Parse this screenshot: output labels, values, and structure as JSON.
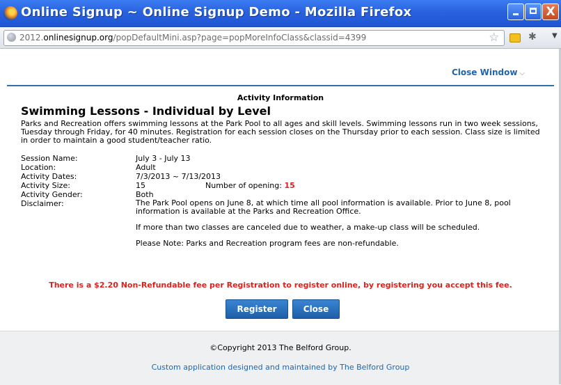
{
  "window": {
    "title": "Online Signup ~ Online Signup Demo - Mozilla Firefox",
    "controls": {
      "minimize": "",
      "maximize": "",
      "close": "X"
    }
  },
  "browser": {
    "url_prefix": "2012.",
    "url_domain": "onlinesignup.org",
    "url_path": "/popDefaultMini.asp?page=popMoreInfoClass&classid=4399",
    "icons": [
      "globe-icon",
      "star-icon",
      "addon-icon",
      "addon-icon",
      "menu-arrow-icon"
    ]
  },
  "page": {
    "close_window": "Close Window",
    "section_heading": "Activity Information",
    "activity_title": "Swimming Lessons - Individual by Level",
    "description": "Parks and Recreation offers swimming lessons at the Park Pool to all ages and skill levels. Swimming lessons run in two week sessions, Tuesday through Friday, for 40 minutes. Registration for each session closes on the Thursday prior to each session. Class size is limited in order to maintain a good student/teacher ratio.",
    "details": {
      "session_name_label": "Session Name:",
      "session_name": "July 3 - July 13",
      "location_label": "Location:",
      "location": "Adult",
      "dates_label": "Activity Dates:",
      "dates": "7/3/2013 ~ 7/13/2013",
      "size_label": "Activity Size:",
      "size": "15",
      "opening_label": "Number of opening:",
      "opening_count": "15",
      "gender_label": "Activity Gender:",
      "gender": "Both",
      "disclaimer_label": "Disclaimer:",
      "disclaimer_paragraphs": [
        "The Park Pool opens on June 8, at which time all pool information is available. Prior to June 8, pool information is available at the Parks and Recreation Office.",
        "If more than two classes are canceled due to weather, a make-up class will be scheduled.",
        "Please Note: Parks and Recreation program fees are non-refundable."
      ]
    },
    "fee_notice": "There is a $2.20 Non-Refundable fee per Registration to register online, by registering you accept this fee.",
    "buttons": {
      "register": "Register",
      "close": "Close"
    }
  },
  "footer": {
    "copyright": "©Copyright 2013 The Belford Group.",
    "custom_app": "Custom application designed and maintained by The Belford Group"
  },
  "colors": {
    "accent": "#2265ad",
    "warning": "#e0201b",
    "titlebar": "#2a62de"
  }
}
